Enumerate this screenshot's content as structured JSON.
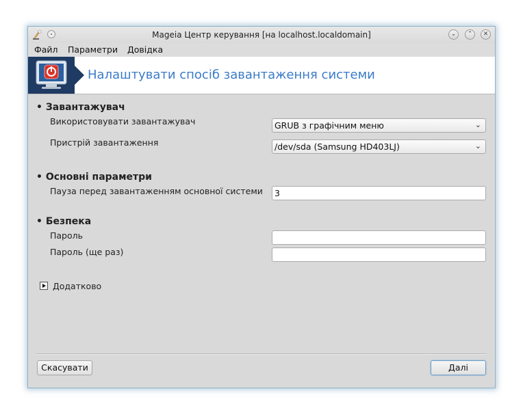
{
  "window": {
    "title": "Mageia Центр керування  [на localhost.localdomain]"
  },
  "menubar": {
    "file": "Файл",
    "settings": "Параметри",
    "help": "Довідка"
  },
  "banner": {
    "title": "Налаштувати спосіб завантаження системи"
  },
  "sections": {
    "bootloader": {
      "heading": "• Завантажувач",
      "use_label": "Використовувати завантажувач",
      "use_value": "GRUB з графічним меню",
      "device_label": "Пристрій завантаження",
      "device_value": "/dev/sda (Samsung HD403LJ)"
    },
    "main": {
      "heading": "• Основні параметри",
      "delay_label": "Пауза перед завантаженням основної системи",
      "delay_value": "3"
    },
    "security": {
      "heading": "• Безпека",
      "password_label": "Пароль",
      "password_value": "",
      "password_again_label": "Пароль (ще раз)",
      "password_again_value": ""
    }
  },
  "advanced": {
    "label": "Додатково"
  },
  "buttons": {
    "cancel": "Скасувати",
    "next": "Далі"
  },
  "colors": {
    "banner_title": "#3a7bc8",
    "icon_bg": "#1f3a63",
    "window_bg": "#d9d9d9"
  },
  "icons": [
    "mageia-app-icon",
    "pin-icon",
    "minimize-icon",
    "maximize-icon",
    "close-icon",
    "power-monitor-icon",
    "chevron-down-icon",
    "expander-arrow-icon"
  ]
}
